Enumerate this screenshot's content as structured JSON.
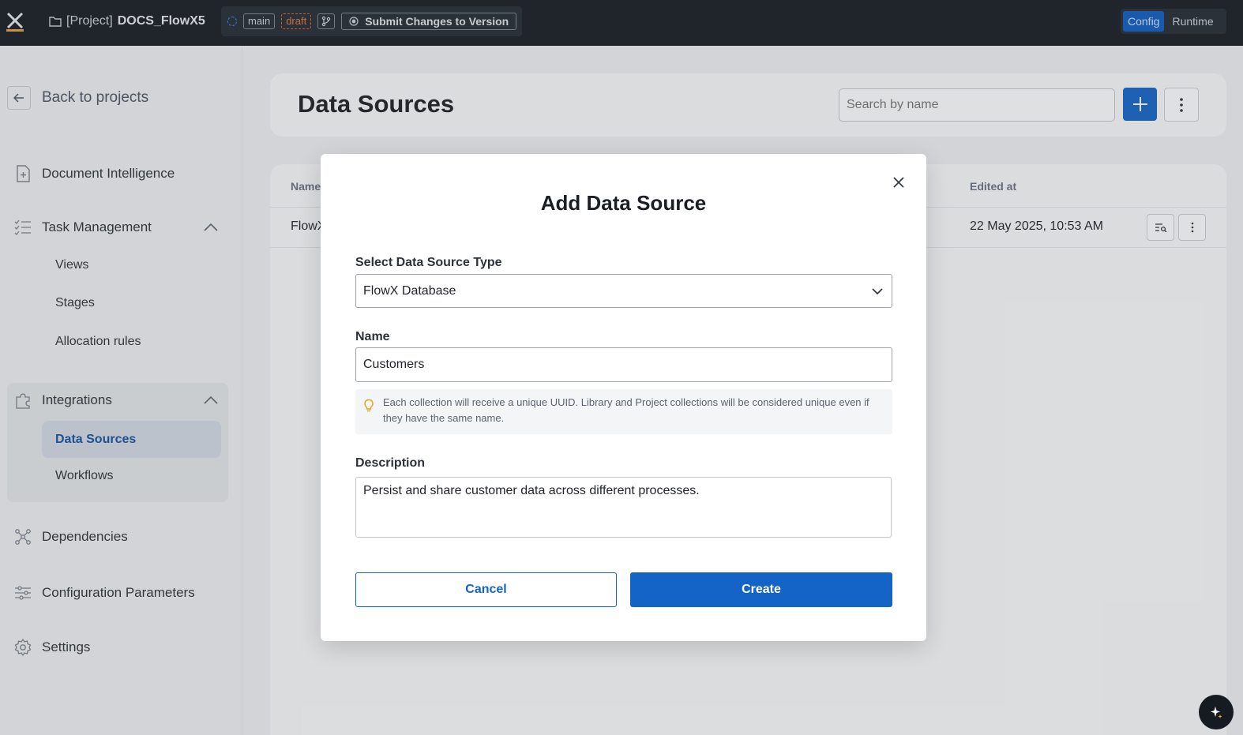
{
  "topbar": {
    "project_prefix": "[Project]",
    "project_name": "DOCS_FlowX5",
    "branch": "main",
    "status": "draft",
    "submit_label": "Submit Changes to Version",
    "mode_config": "Config",
    "mode_runtime": "Runtime"
  },
  "sidebar": {
    "back_label": "Back to projects",
    "items": {
      "document_intelligence": "Document Intelligence",
      "task_management": "Task Management",
      "views": "Views",
      "stages": "Stages",
      "allocation_rules": "Allocation rules",
      "integrations": "Integrations",
      "data_sources": "Data Sources",
      "workflows": "Workflows",
      "dependencies": "Dependencies",
      "configuration_parameters": "Configuration Parameters",
      "settings": "Settings"
    }
  },
  "main": {
    "title": "Data Sources",
    "search_placeholder": "Search by name",
    "columns": {
      "name": "Name",
      "edited_at": "Edited at"
    },
    "rows": [
      {
        "name": "FlowX",
        "edited_at": "22 May 2025, 10:53 AM"
      }
    ]
  },
  "modal": {
    "title": "Add Data Source",
    "type_label": "Select Data Source Type",
    "type_value": "FlowX Database",
    "name_label": "Name",
    "name_value": "Customers",
    "hint": "Each collection will receive a unique UUID. Library and Project collections will be considered unique even if they have the same name.",
    "description_label": "Description",
    "description_value": "Persist and share customer data across different processes.",
    "cancel_label": "Cancel",
    "create_label": "Create"
  },
  "colors": {
    "accent": "#1463c7",
    "topbar": "#161b22",
    "draft": "#e2773f"
  }
}
